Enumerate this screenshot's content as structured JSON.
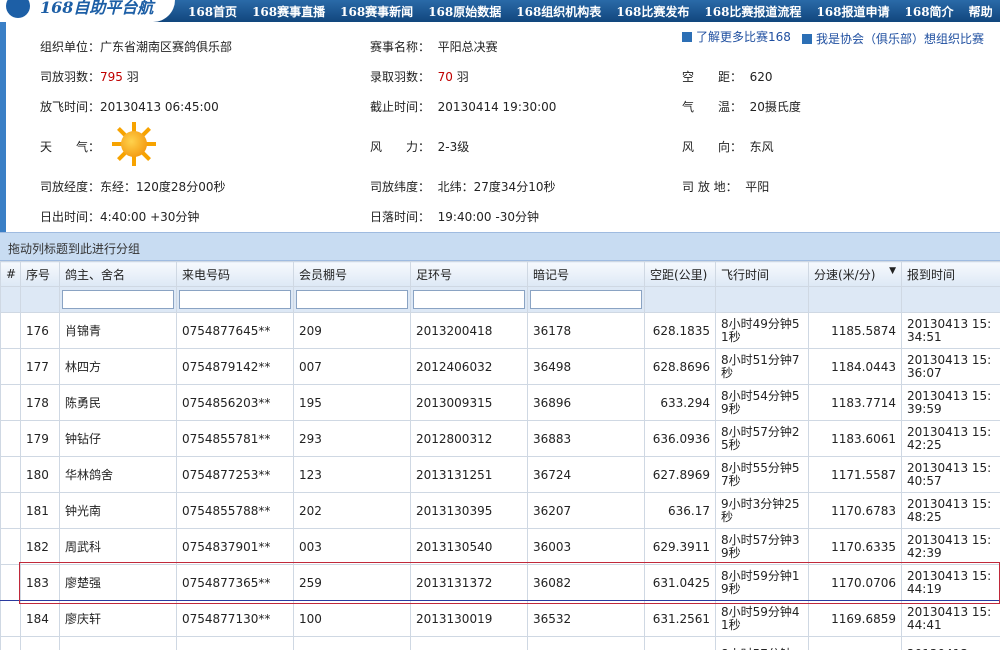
{
  "header": {
    "logo_text": "168自助平台航",
    "nav": [
      "168首页",
      "168赛事直播",
      "168赛事新闻",
      "168原始数据",
      "168组织机构表",
      "168比赛发布",
      "168比赛报道流程",
      "168报道申请",
      "168简介",
      "帮助"
    ]
  },
  "info": {
    "org_label": "组织单位：",
    "org_value": "广东省潮南区赛鸽俱乐部",
    "race_label": "赛事名称：",
    "race_value": "平阳总决赛",
    "release_label": "司放羽数：",
    "release_value": "795",
    "release_unit": "羽",
    "admit_label": "录取羽数：",
    "admit_value": "70",
    "admit_unit": "羽",
    "dist_label": "空　　距：",
    "dist_value": "620",
    "fly_time_label": "放飞时间：",
    "fly_time_value": "20130413 06:45:00",
    "deadline_label": "截止时间：",
    "deadline_value": "20130414 19:30:00",
    "temp_label": "气　　温：",
    "temp_value": "20摄氏度",
    "weather_label": "天　　气：",
    "weather_icon": "sun-icon",
    "wind_label": "风　　力：",
    "wind_value": "2-3级",
    "wind_dir_label": "风　　向：",
    "wind_dir_value": "东风",
    "lon_label": "司放经度：",
    "lon_value": "东经：120度28分00秒",
    "lat_label": "司放纬度：",
    "lat_value": "北纬：27度34分10秒",
    "place_label": "司 放 地：",
    "place_value": "平阳",
    "sunrise_label": "日出时间：",
    "sunrise_value": "4:40:00 +30分钟",
    "sunset_label": "日落时间：",
    "sunset_value": "19:40:00 -30分钟",
    "link_more": "了解更多比赛168",
    "link_org": "我是协会（俱乐部）想组织比赛"
  },
  "grid": {
    "group_hint": "拖动列标题到此进行分组",
    "columns": [
      "#",
      "序号",
      "鸽主、舍名",
      "来电号码",
      "会员棚号",
      "足环号",
      "暗记号",
      "空距(公里)",
      "飞行时间",
      "分速(米/分)",
      "报到时间"
    ],
    "sort_indicator": "▼",
    "rows": [
      [
        "",
        "176",
        "肖锦青",
        "0754877645**",
        "209",
        "2013200418",
        "36178",
        "628.1835",
        "8小时49分钟51秒",
        "1185.5874",
        "20130413 15:34:51"
      ],
      [
        "",
        "177",
        "林四方",
        "0754879142**",
        "007",
        "2012406032",
        "36498",
        "628.8696",
        "8小时51分钟7秒",
        "1184.0443",
        "20130413 15:36:07"
      ],
      [
        "",
        "178",
        "陈勇民",
        "0754856203**",
        "195",
        "2013009315",
        "36896",
        "633.294",
        "8小时54分钟59秒",
        "1183.7714",
        "20130413 15:39:59"
      ],
      [
        "",
        "179",
        "钟钻仔",
        "0754855781**",
        "293",
        "2012800312",
        "36883",
        "636.0936",
        "8小时57分钟25秒",
        "1183.6061",
        "20130413 15:42:25"
      ],
      [
        "",
        "180",
        "华林鸽舍",
        "0754877253**",
        "123",
        "2013131251",
        "36724",
        "627.8969",
        "8小时55分钟57秒",
        "1171.5587",
        "20130413 15:40:57"
      ],
      [
        "",
        "181",
        "钟光南",
        "0754855788**",
        "202",
        "2013130395",
        "36207",
        "636.17",
        "9小时3分钟25秒",
        "1170.6783",
        "20130413 15:48:25"
      ],
      [
        "",
        "182",
        "周武科",
        "0754837901**",
        "003",
        "2013130540",
        "36003",
        "629.3911",
        "8小时57分钟39秒",
        "1170.6335",
        "20130413 15:42:39"
      ],
      [
        "",
        "183",
        "廖楚强",
        "0754877365**",
        "259",
        "2013131372",
        "36082",
        "631.0425",
        "8小时59分钟19秒",
        "1170.0706",
        "20130413 15:44:19"
      ],
      [
        "",
        "184",
        "廖庆轩",
        "0754877130**",
        "100",
        "2013130019",
        "36532",
        "631.2561",
        "8小时59分钟41秒",
        "1169.6859",
        "20130413 15:44:41"
      ],
      [
        "",
        "",
        "",
        "",
        "",
        "",
        "",
        "",
        "8小时57分钟",
        "",
        "20130413"
      ]
    ],
    "selected_row": 7
  }
}
